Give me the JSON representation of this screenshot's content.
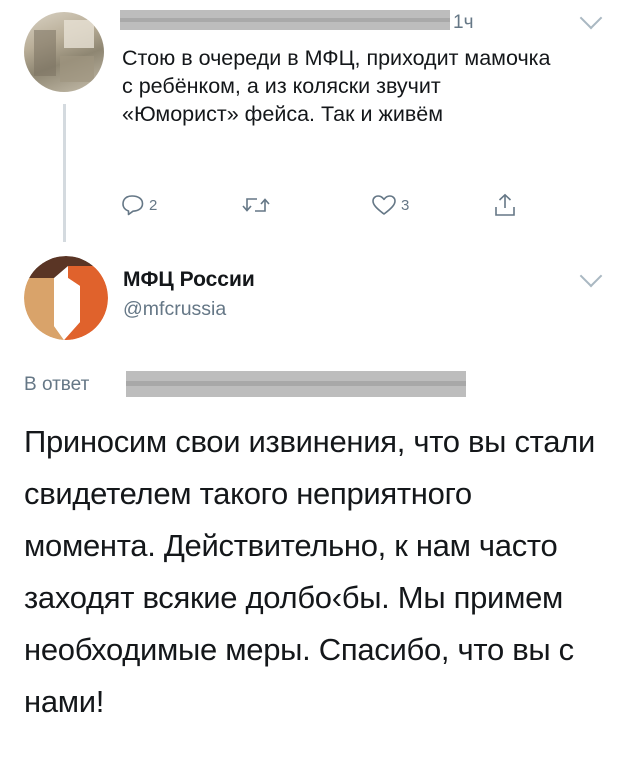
{
  "tweet": {
    "time": "1ч",
    "text": "Стою в очереди в МФЦ, приходит мамочка с ребёнком, а из коляски звучит «Юморист» фейса. Так и живём",
    "replies_count": "2",
    "likes_count": "3"
  },
  "reply_tweet": {
    "author_name": "МФЦ России",
    "author_handle": "@mfcrussia",
    "reply_prefix": "В ответ",
    "text": "Приносим свои извинения, что вы стали свидетелем такого неприятного момента. Действительно, к нам часто заходят всякие долбо‹бы. Мы примем необходимые меры. Спасибо, что вы с нами!"
  },
  "colors": {
    "secondary_text": "#657786",
    "mfc_orange": "#e0622c",
    "mfc_brown": "#5a3525",
    "mfc_tan": "#d9a36a"
  }
}
